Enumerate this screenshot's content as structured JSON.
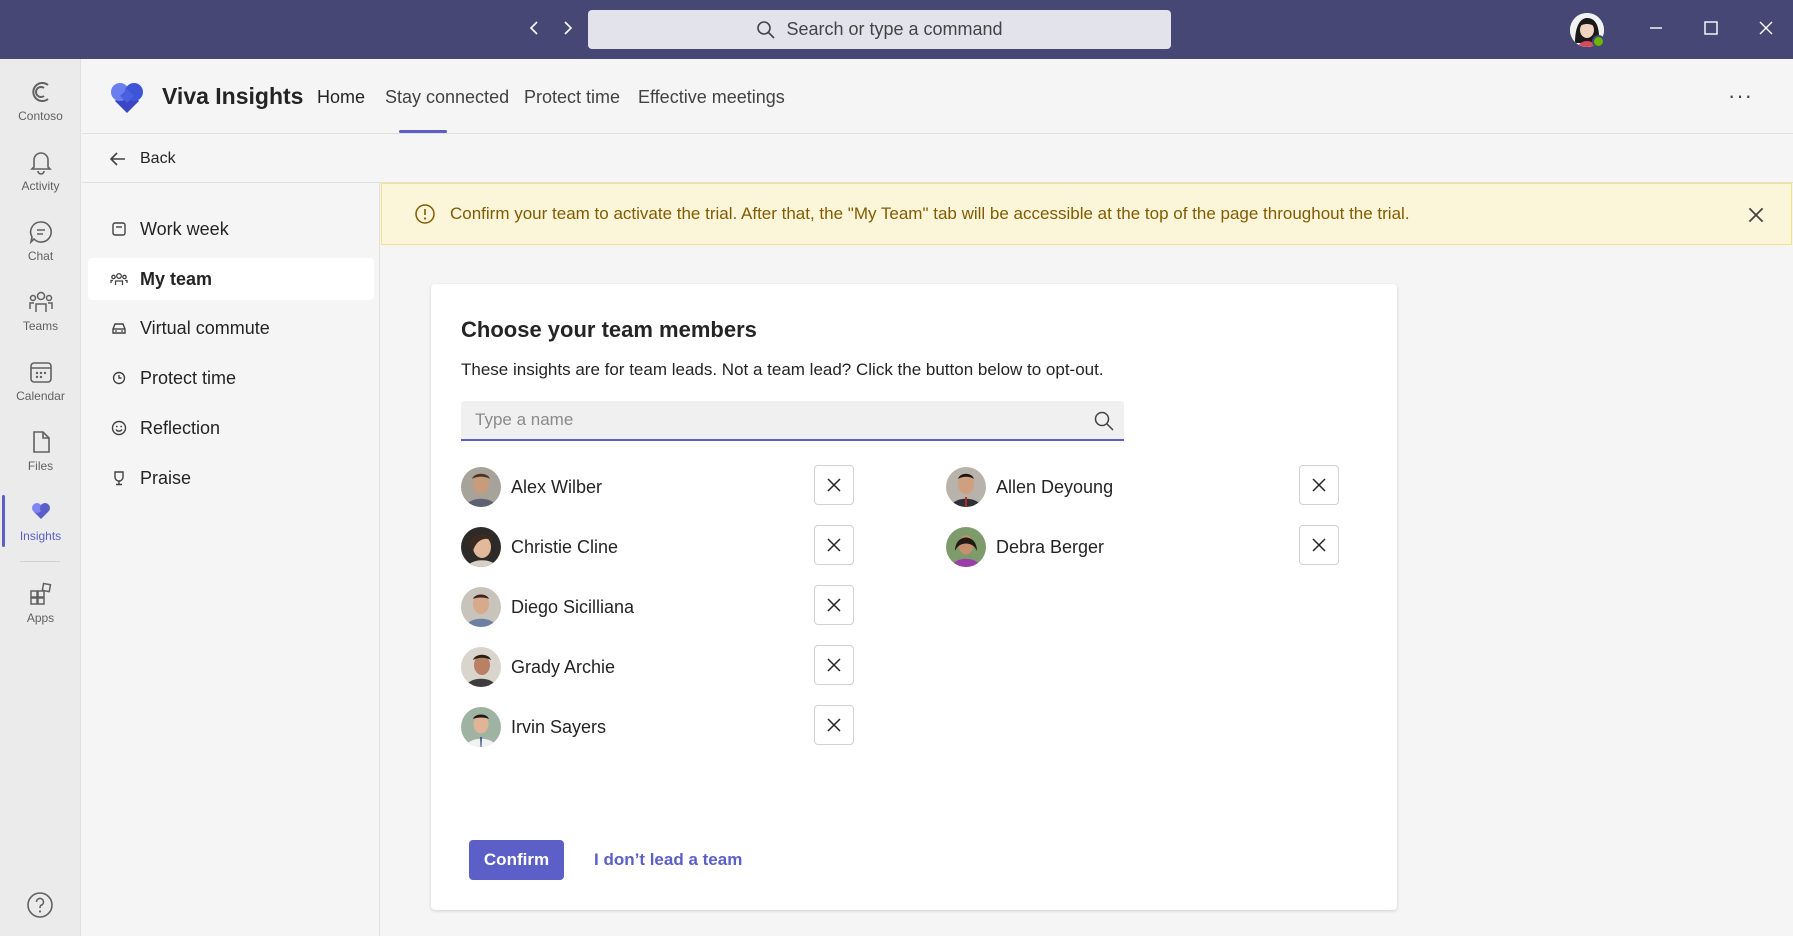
{
  "titlebar": {
    "search_placeholder": "Search or type a command"
  },
  "rail": {
    "items": [
      {
        "label": "Contoso",
        "icon": "contoso-logo-icon"
      },
      {
        "label": "Activity",
        "icon": "bell-icon"
      },
      {
        "label": "Chat",
        "icon": "chat-icon"
      },
      {
        "label": "Teams",
        "icon": "teams-icon"
      },
      {
        "label": "Calendar",
        "icon": "calendar-icon"
      },
      {
        "label": "Files",
        "icon": "file-icon"
      },
      {
        "label": "Insights",
        "icon": "insights-icon",
        "active": true
      },
      {
        "label": "Apps",
        "icon": "apps-icon"
      }
    ]
  },
  "app": {
    "title": "Viva Insights",
    "tabs": [
      {
        "label": "Home",
        "active": true
      },
      {
        "label": "Stay connected"
      },
      {
        "label": "Protect time"
      },
      {
        "label": "Effective meetings"
      }
    ],
    "more_label": "···"
  },
  "back": {
    "label": "Back"
  },
  "leftnav": {
    "items": [
      {
        "label": "Work week",
        "icon": "calendar-small-icon"
      },
      {
        "label": "My team",
        "icon": "people-icon",
        "selected": true
      },
      {
        "label": "Virtual commute",
        "icon": "car-icon"
      },
      {
        "label": "Protect time",
        "icon": "clock-icon"
      },
      {
        "label": "Reflection",
        "icon": "smile-icon"
      },
      {
        "label": "Praise",
        "icon": "trophy-icon"
      }
    ]
  },
  "banner": {
    "text": "Confirm your team to activate the trial. After that, the \"My Team\" tab will be accessible at the top of the page throughout the trial."
  },
  "card": {
    "title": "Choose your team members",
    "subtitle": "These insights are for team leads. Not a team lead? Click the button below to opt-out.",
    "input_placeholder": "Type a name",
    "members": [
      {
        "name": "Alex Wilber"
      },
      {
        "name": "Christie Cline"
      },
      {
        "name": "Diego Sicilliana"
      },
      {
        "name": "Grady Archie"
      },
      {
        "name": "Irvin Sayers"
      },
      {
        "name": "Allen Deyoung"
      },
      {
        "name": "Debra Berger"
      }
    ],
    "confirm_label": "Confirm",
    "optout_label": "I don’t lead a team"
  },
  "colors": {
    "titlebar": "#464775",
    "accent": "#5b5fc7",
    "banner_bg": "#fbf6d9",
    "banner_text": "#835b00"
  }
}
